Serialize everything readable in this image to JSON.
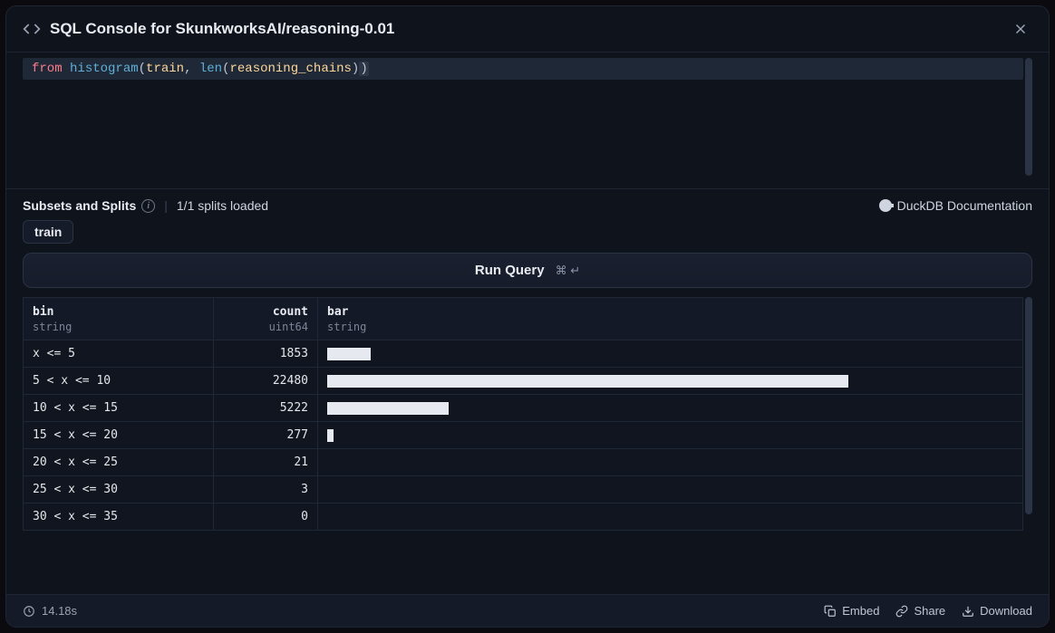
{
  "header": {
    "title": "SQL Console for SkunkworksAI/reasoning-0.01"
  },
  "editor": {
    "code_tokens": {
      "t0": "from",
      "t1": "histogram",
      "t2": "(",
      "t3": "train",
      "t4": ",",
      "t5": "len",
      "t6": "(",
      "t7": "reasoning_chains",
      "t8": ")",
      "t9": ")"
    }
  },
  "subsets": {
    "label": "Subsets and Splits",
    "loaded": "1/1 splits loaded",
    "duckdb": "DuckDB Documentation"
  },
  "chips": {
    "train": "train"
  },
  "run": {
    "label": "Run Query",
    "shortcut": "⌘ ↵"
  },
  "columns": {
    "bin": {
      "name": "bin",
      "type": "string"
    },
    "count": {
      "name": "count",
      "type": "uint64"
    },
    "bar": {
      "name": "bar",
      "type": "string"
    }
  },
  "chart_data": {
    "type": "bar",
    "title": "",
    "xlabel": "bin",
    "ylabel": "count",
    "categories": [
      "x <= 5",
      "5 < x <= 10",
      "10 < x <= 15",
      "15 < x <= 20",
      "20 < x <= 25",
      "25 < x <= 30",
      "30 < x <= 35"
    ],
    "values": [
      1853,
      22480,
      5222,
      277,
      21,
      3,
      0
    ],
    "ylim": [
      0,
      22480
    ]
  },
  "rows": [
    {
      "bin": "x <= 5",
      "count": "1853",
      "barPct": 6.3
    },
    {
      "bin": "5 < x <= 10",
      "count": "22480",
      "barPct": 76
    },
    {
      "bin": "10 < x <= 15",
      "count": "5222",
      "barPct": 17.7
    },
    {
      "bin": "15 < x <= 20",
      "count": "277",
      "barPct": 0.94
    },
    {
      "bin": "20 < x <= 25",
      "count": "21",
      "barPct": 0
    },
    {
      "bin": "25 < x <= 30",
      "count": "3",
      "barPct": 0
    },
    {
      "bin": "30 < x <= 35",
      "count": "0",
      "barPct": 0
    }
  ],
  "footer": {
    "timing": "14.18s",
    "embed": "Embed",
    "share": "Share",
    "download": "Download"
  }
}
